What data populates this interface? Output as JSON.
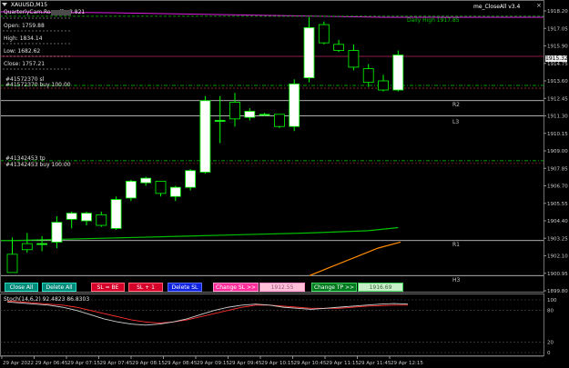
{
  "window": {
    "symbol": "XAUUSD,M15",
    "indicator_name": "me_CloseAll v3.4",
    "overlay_caption": "QuarterlyCam.RoundP v2.821"
  },
  "info_panel": {
    "open": "Open: 1759.88",
    "high": "High: 1834.14",
    "low": "Low: 1682.62",
    "close": "Close: 1757.21"
  },
  "price_axis": {
    "labels": [
      "1918.20",
      "1917.05",
      "1915.90",
      "1914.75",
      "1913.60",
      "1912.45",
      "1911.30",
      "1910.15",
      "1909.00",
      "1907.85",
      "1906.70",
      "1905.55",
      "1904.40",
      "1903.25",
      "1902.10",
      "1900.95",
      "1899.80"
    ],
    "current_price": "1915.32",
    "min": 1899.8,
    "max": 1918.2
  },
  "chart_labels": {
    "daily_high": "Daily High 1917.85",
    "r2": "R2",
    "l3": "L3",
    "r1": "R1",
    "h3": "H3"
  },
  "order_lines": [
    {
      "text": "#41572370 sl",
      "sub": "#41572370 buy 100.00",
      "price": 1913.3
    },
    {
      "text": "#41342453 tp",
      "sub": "#41342453 buy 100.00",
      "price": 1908.35
    }
  ],
  "levels": [
    {
      "key": "daily_high",
      "price": 1917.85,
      "color": "#00c000"
    },
    {
      "key": "r2",
      "price": 1912.3,
      "color": "#e8e8e8"
    },
    {
      "key": "l3",
      "price": 1911.3,
      "color": "#e8e8e8"
    },
    {
      "key": "r1",
      "price": 1903.1,
      "color": "#e8e8e8"
    },
    {
      "key": "h3",
      "price": 1900.8,
      "color": "#e8e8e8"
    }
  ],
  "buttons": {
    "close_all": "Close All",
    "delete_all": "Delete All",
    "sl_be": "SL = BE",
    "sl_plus": "SL + 1",
    "delete_sl": "Delete SL",
    "change_sl": "Change SL >>",
    "sl_value": "1912.55",
    "change_tp": "Change TP >>",
    "tp_value": "1916.69"
  },
  "stoch": {
    "label": "Stoch(14,6,2) 92.4823 86.8303",
    "axis": [
      "100",
      "80",
      "20",
      "0"
    ],
    "main": [
      96,
      94,
      92,
      90,
      86,
      80,
      72,
      64,
      58,
      54,
      52,
      54,
      58,
      64,
      72,
      80,
      86,
      90,
      92,
      90,
      86,
      84,
      82,
      84,
      86,
      88,
      90,
      92,
      93,
      92
    ],
    "signal": [
      98,
      96,
      94,
      92,
      90,
      86,
      80,
      74,
      68,
      62,
      58,
      56,
      58,
      62,
      68,
      74,
      80,
      86,
      90,
      90,
      88,
      86,
      84,
      84,
      84,
      86,
      88,
      89,
      90,
      90
    ]
  },
  "time_axis": [
    "29 Apr 2022",
    "29 Apr 06:45",
    "29 Apr 07:15",
    "29 Apr 07:45",
    "29 Apr 08:15",
    "29 Apr 08:45",
    "29 Apr 09:15",
    "29 Apr 09:45",
    "29 Apr 10:15",
    "29 Apr 10:45",
    "29 Apr 11:15",
    "29 Apr 11:45",
    "29 Apr 12:15"
  ],
  "candles": [
    {
      "o": 1902.2,
      "h": 1903.3,
      "l": 1901.0,
      "c": 1901.0
    },
    {
      "o": 1902.9,
      "h": 1903.6,
      "l": 1902.3,
      "c": 1902.5
    },
    {
      "o": 1902.9,
      "h": 1903.4,
      "l": 1902.4,
      "c": 1902.9
    },
    {
      "o": 1903.0,
      "h": 1904.7,
      "l": 1902.6,
      "c": 1904.3
    },
    {
      "o": 1904.5,
      "h": 1905.0,
      "l": 1903.9,
      "c": 1904.9
    },
    {
      "o": 1904.4,
      "h": 1905.0,
      "l": 1904.1,
      "c": 1904.9
    },
    {
      "o": 1904.8,
      "h": 1905.0,
      "l": 1904.0,
      "c": 1904.1
    },
    {
      "o": 1903.9,
      "h": 1906.0,
      "l": 1903.8,
      "c": 1905.8
    },
    {
      "o": 1905.9,
      "h": 1907.1,
      "l": 1905.7,
      "c": 1907.0
    },
    {
      "o": 1906.9,
      "h": 1907.3,
      "l": 1906.7,
      "c": 1907.2
    },
    {
      "o": 1907.0,
      "h": 1907.0,
      "l": 1906.0,
      "c": 1906.2
    },
    {
      "o": 1906.0,
      "h": 1906.7,
      "l": 1905.7,
      "c": 1906.6
    },
    {
      "o": 1906.6,
      "h": 1907.8,
      "l": 1906.4,
      "c": 1907.7
    },
    {
      "o": 1907.6,
      "h": 1912.6,
      "l": 1907.5,
      "c": 1912.3
    },
    {
      "o": 1911.0,
      "h": 1912.6,
      "l": 1909.5,
      "c": 1911.0
    },
    {
      "o": 1912.2,
      "h": 1912.8,
      "l": 1910.6,
      "c": 1911.1
    },
    {
      "o": 1911.2,
      "h": 1911.8,
      "l": 1911.0,
      "c": 1911.6
    },
    {
      "o": 1911.4,
      "h": 1911.5,
      "l": 1911.3,
      "c": 1911.4
    },
    {
      "o": 1911.4,
      "h": 1911.4,
      "l": 1910.5,
      "c": 1910.6
    },
    {
      "o": 1910.6,
      "h": 1913.7,
      "l": 1910.3,
      "c": 1913.4
    },
    {
      "o": 1913.8,
      "h": 1917.8,
      "l": 1913.5,
      "c": 1917.1
    },
    {
      "o": 1917.3,
      "h": 1917.5,
      "l": 1916.0,
      "c": 1916.1
    },
    {
      "o": 1916.0,
      "h": 1916.3,
      "l": 1915.5,
      "c": 1915.6
    },
    {
      "o": 1915.6,
      "h": 1916.0,
      "l": 1914.3,
      "c": 1914.5
    },
    {
      "o": 1914.4,
      "h": 1914.7,
      "l": 1913.2,
      "c": 1913.5
    },
    {
      "o": 1913.6,
      "h": 1914.0,
      "l": 1912.9,
      "c": 1913.0
    },
    {
      "o": 1913.0,
      "h": 1915.6,
      "l": 1912.9,
      "c": 1915.3
    }
  ],
  "ma_points": [
    [
      1903.1,
      0
    ],
    [
      1903.2,
      4
    ],
    [
      1903.3,
      8
    ],
    [
      1903.4,
      12
    ],
    [
      1903.5,
      16
    ],
    [
      1903.6,
      20
    ],
    [
      1903.75,
      24
    ],
    [
      1903.95,
      26
    ]
  ],
  "ma2_points": [
    [
      1900.8,
      0
    ],
    [
      1901.4,
      1
    ],
    [
      1902.0,
      2
    ],
    [
      1902.6,
      3
    ],
    [
      1903.0,
      4
    ]
  ],
  "colors": {
    "bull": "#ffffff",
    "bear": "#000000",
    "wick": "#00ff00",
    "ma": "#00c000",
    "ma2": "#ff8c00",
    "top_line": "#e020e0",
    "grid": "#3a3a3a",
    "stoch_main": "#d0d0d0",
    "stoch_signal": "#ff3030"
  },
  "icons": {
    "dropdown": "triangle-down-icon",
    "close": "close-icon"
  }
}
